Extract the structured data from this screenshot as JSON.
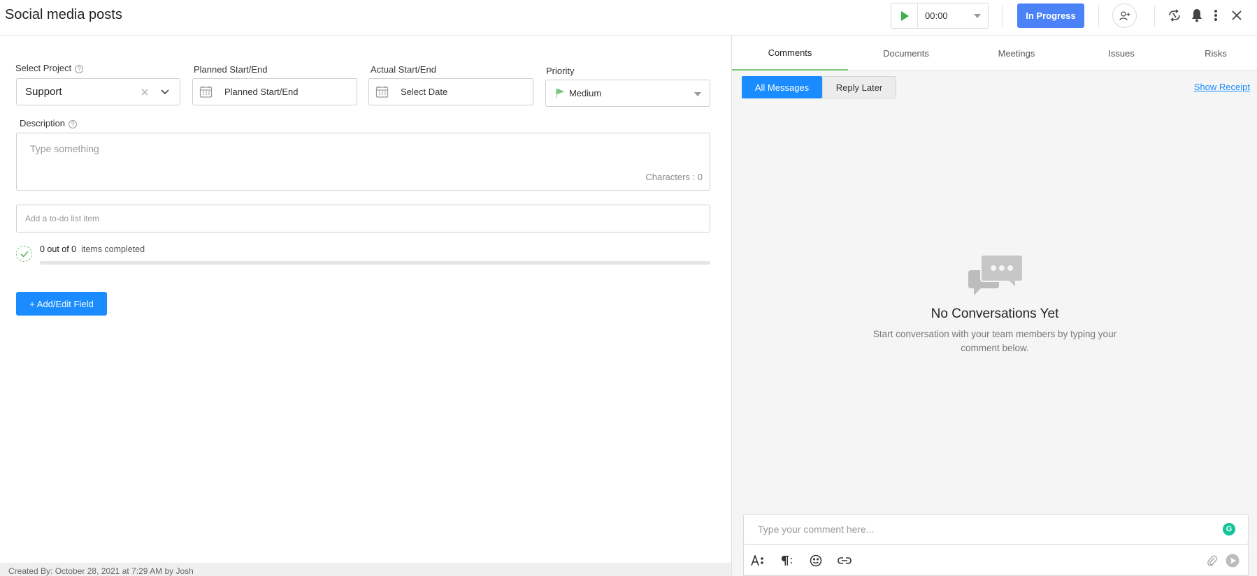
{
  "header": {
    "title": "Social media posts",
    "timer_value": "00:00",
    "status_label": "In Progress"
  },
  "form": {
    "select_project": {
      "label": "Select Project",
      "value": "Support"
    },
    "planned": {
      "label": "Planned Start/End",
      "placeholder": "Planned Start/End"
    },
    "actual": {
      "label": "Actual Start/End",
      "placeholder": "Select Date"
    },
    "priority": {
      "label": "Priority",
      "value": "Medium"
    },
    "description": {
      "label": "Description",
      "placeholder": "Type something",
      "char_count": "Characters : 0"
    },
    "todo": {
      "placeholder": "Add a to-do list item"
    },
    "progress": {
      "count": "0 out of 0",
      "suffix": "items completed",
      "fraction": 0
    },
    "add_field_label": "+ Add/Edit Field"
  },
  "footer": {
    "created_by": "Created By: October 28, 2021 at 7:29 AM by Josh"
  },
  "panel": {
    "tabs": [
      "Comments",
      "Documents",
      "Meetings",
      "Issues",
      "Risks"
    ],
    "active_tab": "Comments",
    "filters": {
      "all": "All Messages",
      "later": "Reply Later"
    },
    "show_receipt": "Show Receipt",
    "empty": {
      "title": "No Conversations Yet",
      "subtitle": "Start conversation with your team members by typing your comment below."
    },
    "comment_placeholder": "Type your comment here..."
  },
  "colors": {
    "accent_blue": "#1a8cff",
    "status_blue": "#4c82f7",
    "green": "#7bc67b"
  }
}
